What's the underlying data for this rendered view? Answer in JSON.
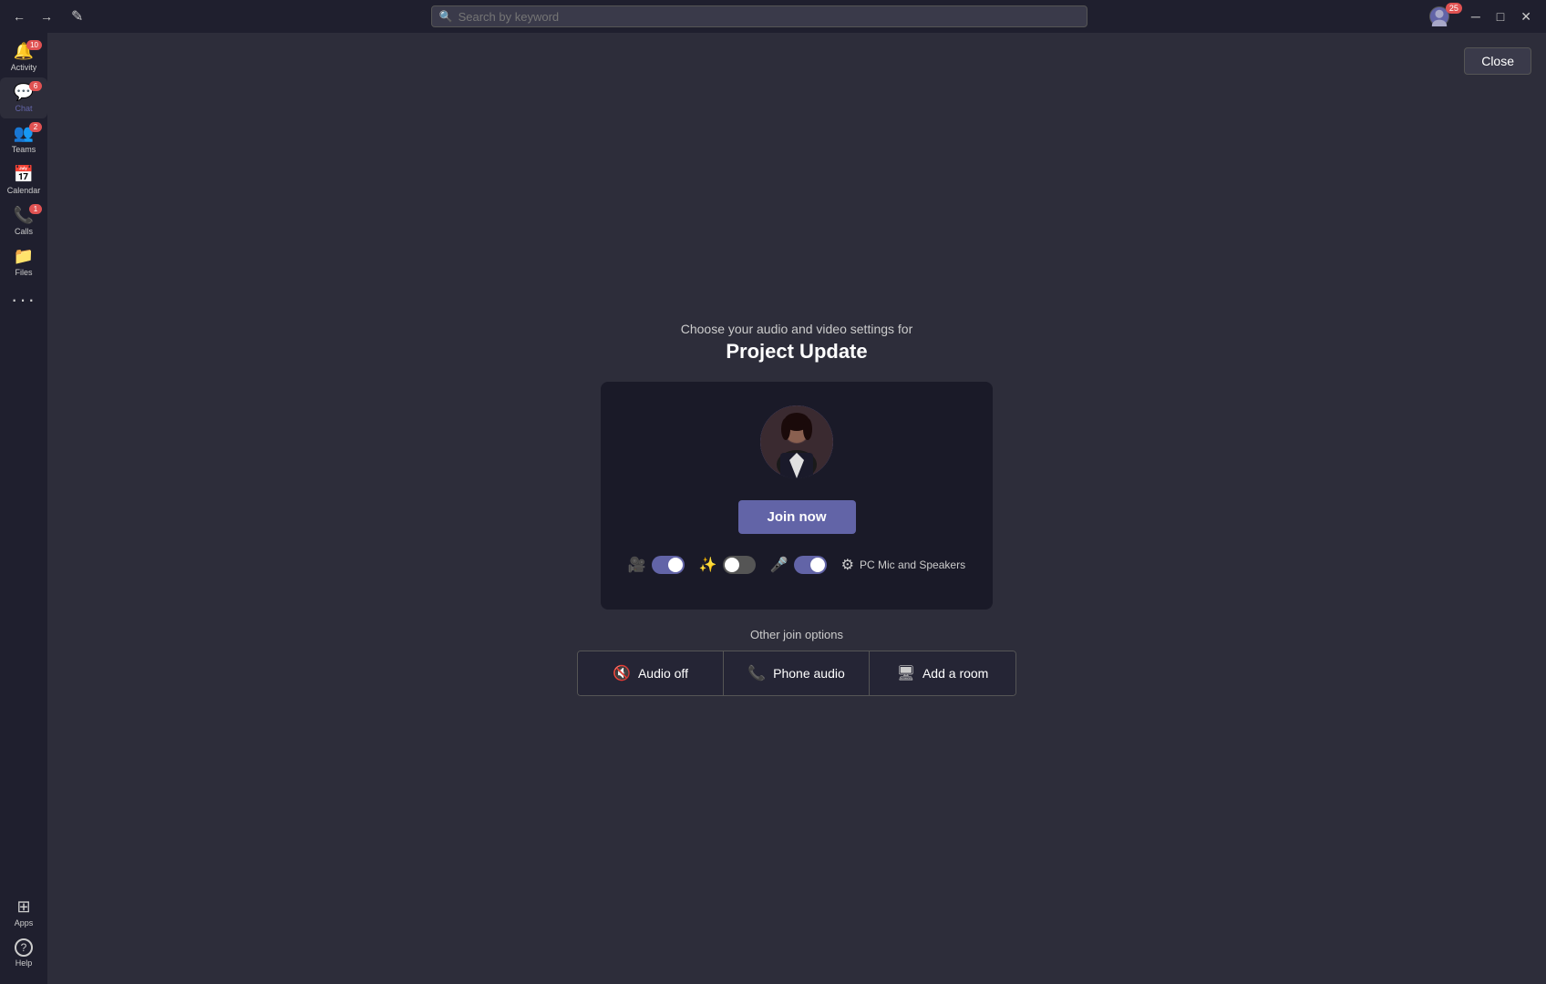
{
  "titlebar": {
    "nav_back": "←",
    "nav_forward": "→",
    "compose_icon": "✎",
    "search_placeholder": "Search by keyword",
    "badge_count": "25",
    "window_minimize": "─",
    "window_restore": "□",
    "window_close": "✕"
  },
  "sidebar": {
    "items": [
      {
        "id": "activity",
        "label": "Activity",
        "icon": "🔔",
        "badge": "10",
        "active": false
      },
      {
        "id": "chat",
        "label": "Chat",
        "icon": "💬",
        "badge": "6",
        "active": true
      },
      {
        "id": "teams",
        "label": "Teams",
        "icon": "👥",
        "badge": "2",
        "active": false
      },
      {
        "id": "calendar",
        "label": "Calendar",
        "icon": "📅",
        "badge": "",
        "active": false
      },
      {
        "id": "calls",
        "label": "Calls",
        "icon": "📞",
        "badge": "1",
        "active": false
      },
      {
        "id": "files",
        "label": "Files",
        "icon": "📁",
        "badge": "",
        "active": false
      },
      {
        "id": "more",
        "label": "...",
        "icon": "•••",
        "badge": "",
        "active": false
      }
    ],
    "bottom_items": [
      {
        "id": "apps",
        "label": "Apps",
        "icon": "⊞",
        "badge": ""
      },
      {
        "id": "help",
        "label": "Help",
        "icon": "?",
        "badge": ""
      }
    ]
  },
  "close_button_label": "Close",
  "prejoin": {
    "subtitle": "Choose your audio and video settings for",
    "title": "Project Update",
    "join_button_label": "Join now"
  },
  "controls": {
    "video_toggle_on": true,
    "effects_toggle_off": false,
    "mic_toggle_on": true,
    "speaker_label": "PC Mic and Speakers"
  },
  "other_options": {
    "label": "Other join options",
    "options": [
      {
        "id": "audio-off",
        "icon": "🔇",
        "label": "Audio off"
      },
      {
        "id": "phone-audio",
        "icon": "📞",
        "label": "Phone audio"
      },
      {
        "id": "add-room",
        "icon": "🖥",
        "label": "Add a room"
      }
    ]
  }
}
